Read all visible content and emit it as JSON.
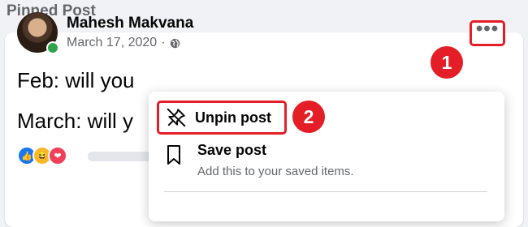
{
  "section": {
    "title": "Pinned Post"
  },
  "post": {
    "author": "Mahesh Makvana",
    "date": "March 17, 2020",
    "separator": "·",
    "lines": [
      "Feb: will you",
      "March: will y"
    ],
    "reactions": [
      "like-icon",
      "haha-icon",
      "love-icon"
    ]
  },
  "menu": {
    "more_button": "•••",
    "items": [
      {
        "label": "Unpin post",
        "icon": "unpin-icon"
      },
      {
        "label": "Save post",
        "description": "Add this to your saved items.",
        "icon": "bookmark-icon"
      }
    ]
  },
  "annotations": {
    "step1": "1",
    "step2": "2"
  },
  "colors": {
    "highlight": "#e41e26",
    "online": "#31a24c",
    "like": "#1877f2",
    "haha": "#f7b928",
    "love": "#f33e58"
  }
}
